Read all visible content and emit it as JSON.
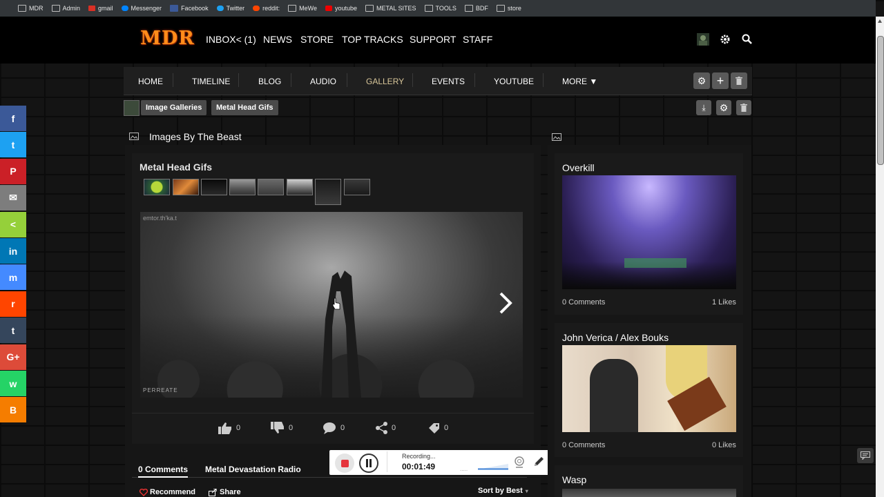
{
  "bookmarks": [
    "MDR",
    "Admin",
    "gmail",
    "Messenger",
    "Facebook",
    "Twitter",
    "reddit:",
    "MeWe",
    "youtube",
    "METAL SITES",
    "TOOLS",
    "BDF",
    "store"
  ],
  "logo_text": "MDR",
  "top_nav": [
    "INBOX< (1)",
    "NEWS",
    "STORE",
    "TOP TRACKS",
    "SUPPORT",
    "STAFF"
  ],
  "sub_nav": [
    "HOME",
    "TIMELINE",
    "BLOG",
    "AUDIO",
    "GALLERY",
    "EVENTS",
    "YOUTUBE",
    "MORE ▼"
  ],
  "breadcrumbs": [
    "Image Galleries",
    "Metal Head Gifs"
  ],
  "panel_title": "Images By The Beast",
  "gallery_title": "Metal Head Gifs",
  "viewer": {
    "watermark_top": "emtor.th'ka.t",
    "watermark_bottom": "PERREATE"
  },
  "actions": {
    "likes": "0",
    "dislikes": "0",
    "comments": "0",
    "shares": "0",
    "tags": "0"
  },
  "tabs": {
    "comments": "0 Comments",
    "site": "Metal Devastation Radio"
  },
  "bottom": {
    "recommend": "Recommend",
    "share": "Share",
    "sort": "Sort by Best"
  },
  "recorder": {
    "status": "Recording...",
    "time": "00:01:49"
  },
  "right_cards": [
    {
      "title": "Overkill",
      "comments": "0 Comments",
      "likes": "1 Likes"
    },
    {
      "title": "John Verica / Alex Bouks",
      "comments": "0 Comments",
      "likes": "0 Likes"
    },
    {
      "title": "Wasp"
    }
  ],
  "share_sidebar": [
    {
      "name": "facebook",
      "glyph": "f",
      "color": "#3b5998"
    },
    {
      "name": "twitter",
      "glyph": "t",
      "color": "#1da1f2"
    },
    {
      "name": "pinterest",
      "glyph": "P",
      "color": "#cb2027"
    },
    {
      "name": "email",
      "glyph": "✉",
      "color": "#7d7d7d"
    },
    {
      "name": "sharethis",
      "glyph": "<",
      "color": "#95d03a"
    },
    {
      "name": "linkedin",
      "glyph": "in",
      "color": "#0077b5"
    },
    {
      "name": "messenger",
      "glyph": "m",
      "color": "#448aff"
    },
    {
      "name": "reddit",
      "glyph": "r",
      "color": "#ff4500"
    },
    {
      "name": "tumblr",
      "glyph": "t",
      "color": "#35465c"
    },
    {
      "name": "googleplus",
      "glyph": "G+",
      "color": "#dd4b39"
    },
    {
      "name": "whatsapp",
      "glyph": "w",
      "color": "#25d366"
    },
    {
      "name": "blogger",
      "glyph": "B",
      "color": "#f57d00"
    }
  ]
}
